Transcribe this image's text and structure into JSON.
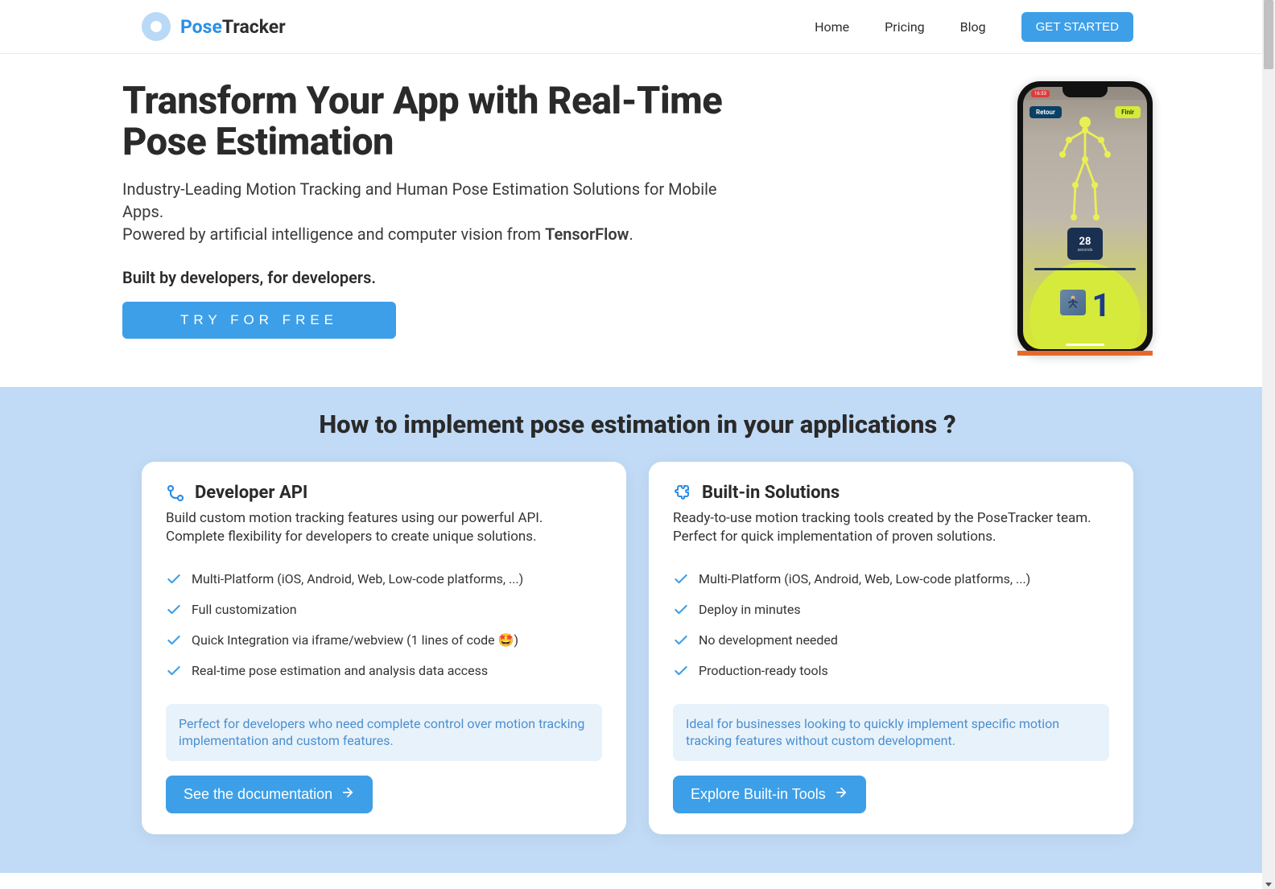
{
  "brand": {
    "part1": "Pose",
    "part2": "Tracker"
  },
  "nav": {
    "home": "Home",
    "pricing": "Pricing",
    "blog": "Blog",
    "cta": "GET STARTED"
  },
  "hero": {
    "title": "Transform Your App with Real-Time Pose Estimation",
    "subtitle_a": "Industry-Leading Motion Tracking and Human Pose Estimation Solutions for Mobile Apps.",
    "subtitle_b_pre": "Powered by artificial intelligence and computer vision from ",
    "subtitle_b_strong": "TensorFlow",
    "subtitle_b_post": ".",
    "tagline": "Built by developers, for developers.",
    "cta": "TRY FOR FREE"
  },
  "phone": {
    "time": "16:53",
    "retour": "Retour",
    "finir": "Finir",
    "counter_num": "28",
    "counter_label": "seconds",
    "bignum": "1"
  },
  "implement": {
    "heading": "How to implement pose estimation in your applications ?",
    "cards": [
      {
        "title": "Developer API",
        "desc": "Build custom motion tracking features using our powerful API. Complete flexibility for developers to create unique solutions.",
        "features": [
          "Multi-Platform (iOS, Android, Web, Low-code platforms, ...)",
          "Full customization",
          "Quick Integration via iframe/webview (1 lines of code 🤩)",
          "Real-time pose estimation and analysis data access"
        ],
        "callout": "Perfect for developers who need complete control over motion tracking implementation and custom features.",
        "cta": "See the documentation"
      },
      {
        "title": "Built-in Solutions",
        "desc": "Ready-to-use motion tracking tools created by the PoseTracker team. Perfect for quick implementation of proven solutions.",
        "features": [
          "Multi-Platform (iOS, Android, Web, Low-code platforms, ...)",
          "Deploy in minutes",
          "No development needed",
          "Production-ready tools"
        ],
        "callout": "Ideal for businesses looking to quickly implement specific motion tracking features without custom development.",
        "cta": "Explore Built-in Tools"
      }
    ]
  }
}
